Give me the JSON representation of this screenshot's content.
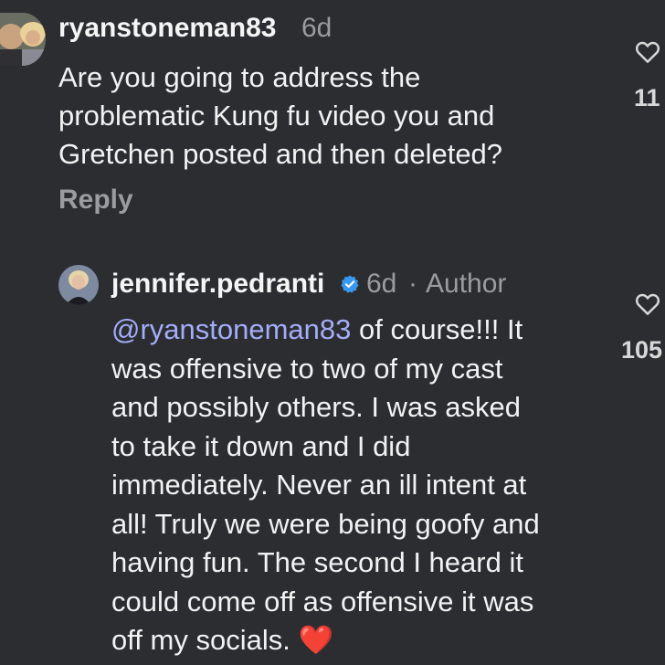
{
  "comments": [
    {
      "username": "ryanstoneman83",
      "age": "6d",
      "text": "Are you going to address the\nproblematic Kung fu video you and\nGretchen posted and then deleted?",
      "reply_label": "Reply",
      "like_count": "11",
      "like_icon": "heart-outline-icon"
    },
    {
      "username": "jennifer.pedranti",
      "verified": true,
      "age": "6d",
      "separator": "·",
      "author_label": "Author",
      "mention": "@ryanstoneman83",
      "text_after_mention": " of course!!! It\nwas offensive to two of my cast\nand possibly others. I was asked\nto take it down and I did\nimmediately. Never an ill intent at\nall! Truly we were being goofy and\nhaving fun. The second I heard it\ncould come off as offensive it was\noff my socials. ",
      "emoji": "❤️",
      "like_count": "105",
      "like_icon": "heart-outline-icon"
    }
  ],
  "colors": {
    "background": "#2b2d31",
    "mention": "#a4adf7",
    "muted": "#9a9ca1",
    "verified": "#3897f0",
    "heart": "#e0203a"
  }
}
